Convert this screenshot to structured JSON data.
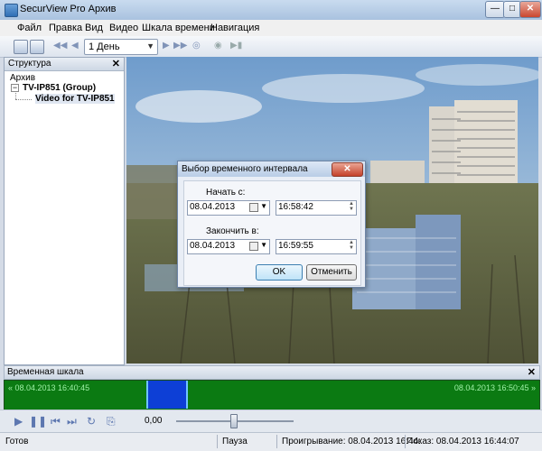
{
  "window": {
    "title": "SecurView Pro Архив"
  },
  "menu": [
    "Файл",
    "Правка",
    "Вид",
    "Видео",
    "Шкала времени",
    "Навигация"
  ],
  "toolbar": {
    "day_select": "1 День"
  },
  "structure": {
    "title": "Структура",
    "root": "Архив",
    "group": "TV-IP851 (Group)",
    "item": "Video for TV-IP851"
  },
  "dialog": {
    "title": "Выбор временного интервала",
    "start_label": "Начать с:",
    "start_date": "08.04.2013",
    "start_time": "16:58:42",
    "end_label": "Закончить в:",
    "end_date": "08.04.2013",
    "end_time": "16:59:55",
    "ok": "OK",
    "cancel": "Отменить"
  },
  "timeline": {
    "title": "Временная шкала",
    "left": "« 08.04.2013 16:40:45",
    "right": "08.04.2013 16:50:45 »"
  },
  "controls": {
    "speed": "0,00"
  },
  "status": {
    "ready": "Готов",
    "pause": "Пауза",
    "playing": "Проигрывание: 08.04.2013 16:44:",
    "showing": "Показ: 08.04.2013 16:44:07"
  },
  "colors": {
    "timeline_bg": "#0b7a12",
    "selection": "#0d3fd6"
  }
}
